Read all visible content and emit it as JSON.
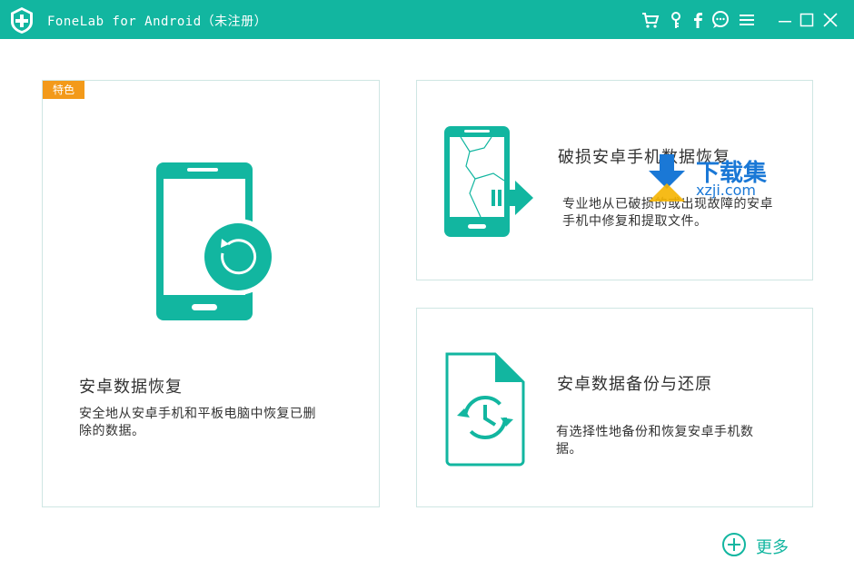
{
  "app": {
    "title": "FoneLab for Android（未注册）"
  },
  "colors": {
    "accent": "#12b6a0",
    "badge": "#f39a1a",
    "border": "#cfe6e3",
    "watermark": "#1a78d6"
  },
  "toolbar_icons": [
    "cart-icon",
    "key-icon",
    "facebook-icon",
    "chat-icon",
    "menu-icon",
    "minimize-icon",
    "maximize-icon",
    "close-icon"
  ],
  "cards": {
    "recovery": {
      "badge": "特色",
      "title": "安卓数据恢复",
      "desc_line1": "安全地从安卓手机和平板电脑中恢复已删",
      "desc_line2": "除的数据。",
      "icon": "phone-restore-icon"
    },
    "broken": {
      "title": "破损安卓手机数据恢复",
      "desc_line1": "专业地从已破损的或出现故障的安卓",
      "desc_line2": "手机中修复和提取文件。",
      "icon": "broken-phone-icon"
    },
    "backup": {
      "title": "安卓数据备份与还原",
      "desc_line1": "有选择性地备份和恢复安卓手机数",
      "desc_line2": "据。",
      "icon": "backup-file-icon"
    }
  },
  "more": {
    "label": "更多"
  },
  "watermark": {
    "brand": "下载集",
    "url": "xzji.com"
  }
}
